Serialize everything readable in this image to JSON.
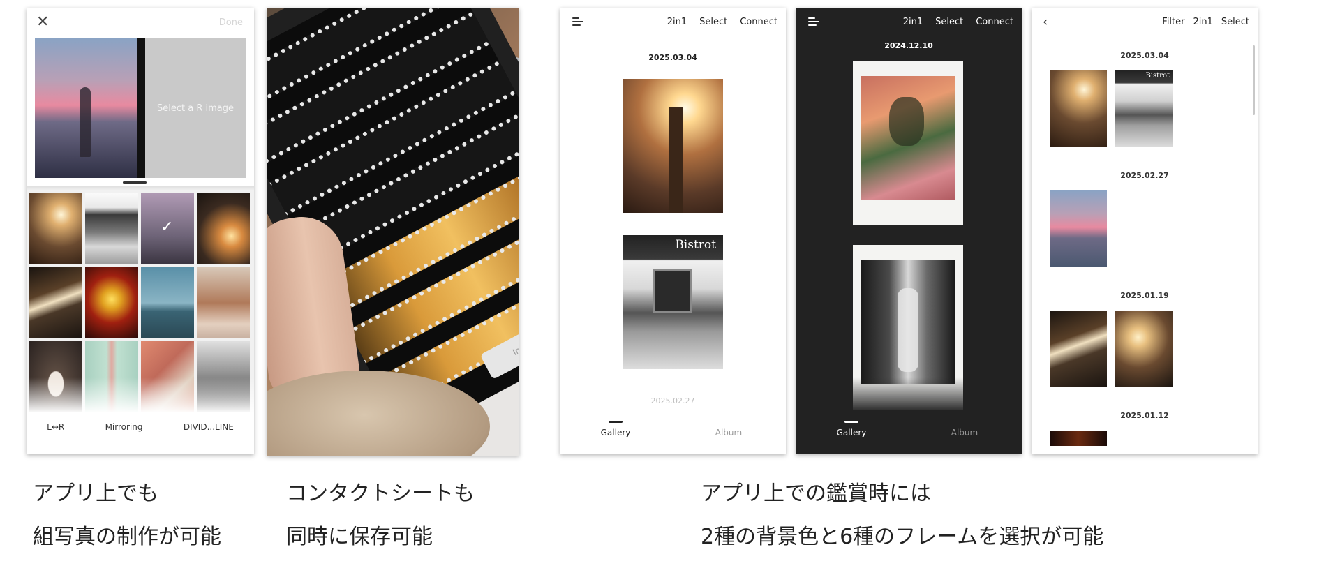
{
  "collage_editor": {
    "done_label": "Done",
    "placeholder_text": "Select a R image",
    "options": [
      "L↔R",
      "Mirroring",
      "DIVID...LINE"
    ]
  },
  "contact_sheet_photo": {
    "toast_text": "Interrupt"
  },
  "gallery_light": {
    "nav": [
      "2in1",
      "Select",
      "Connect"
    ],
    "dates": [
      "2025.03.04",
      "2025.02.27"
    ],
    "sign_text": "Bistrot",
    "tabs": [
      "Gallery",
      "Album"
    ],
    "colors": {
      "background": "#ffffff",
      "text": "#222222"
    }
  },
  "gallery_dark": {
    "nav": [
      "2in1",
      "Select",
      "Connect"
    ],
    "dates": [
      "2024.12.10"
    ],
    "tabs": [
      "Gallery",
      "Album"
    ],
    "colors": {
      "background": "#222222",
      "text": "#ffffff"
    }
  },
  "gallery_grid": {
    "nav": [
      "Filter",
      "2in1",
      "Select"
    ],
    "dates": [
      "2025.03.04",
      "2025.02.27",
      "2025.01.19",
      "2025.01.12"
    ],
    "sign_text": "Bistrot"
  },
  "captions": {
    "left": [
      "アプリ上でも",
      "組写真の制作が可能"
    ],
    "middle": [
      "コンタクトシートも",
      "同時に保存可能"
    ],
    "right": [
      "アプリ上での鑑賞時には",
      "2種の背景色と6種のフレームを選択が可能"
    ]
  },
  "icons": {
    "close": "close-icon",
    "check": "checkmark-icon",
    "menu": "menu-icon",
    "back": "chevron-left-icon"
  }
}
